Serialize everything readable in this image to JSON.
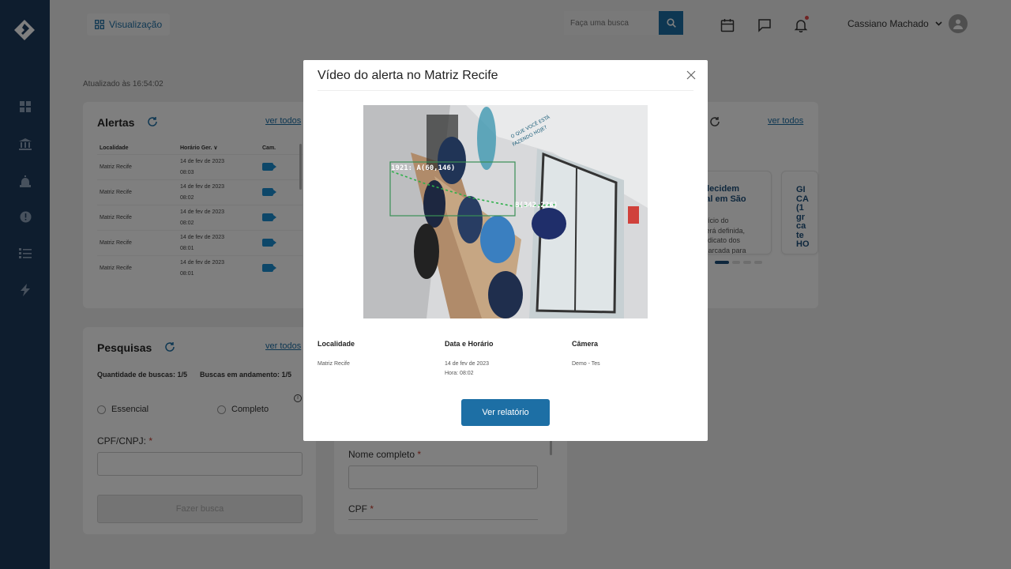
{
  "topbar": {
    "viz_label": "Visualização",
    "search_placeholder": "Faça uma busca",
    "user_name": "Cassiano Machado"
  },
  "updated_text": "Atualizado às 16:54:02",
  "alerts": {
    "title": "Alertas",
    "ver_todos": "ver todos",
    "headers": [
      "Localidade",
      "Horário Ger.",
      "Cam."
    ],
    "rows": [
      {
        "local": "Matriz Recife",
        "date": "14 de fev de 2023",
        "time": "08:03"
      },
      {
        "local": "Matriz Recife",
        "date": "14 de fev de 2023",
        "time": "08:02"
      },
      {
        "local": "Matriz Recife",
        "date": "14 de fev de 2023",
        "time": "08:02"
      },
      {
        "local": "Matriz Recife",
        "date": "14 de fev de 2023",
        "time": "08:01"
      },
      {
        "local": "Matriz Recife",
        "date": "14 de fev de 2023",
        "time": "08:01"
      }
    ]
  },
  "news": {
    "ver_todos": "ver todos",
    "card1_title_1": "elecidem",
    "card1_title_2": "ral em São",
    "card1_text_1": "início do",
    "card1_text_2": "será definida,",
    "card1_text_3": "indicato dos",
    "card1_text_4": "marcada para",
    "card2_lines": [
      "GI",
      "CA",
      "(1",
      "gr",
      "ca",
      "te",
      "HO"
    ]
  },
  "pesquisas": {
    "title": "Pesquisas",
    "ver_todos": "ver todos",
    "qtd_label": "Quantidade de buscas: 1/5",
    "andamento_label": "Buscas em andamento: 1/5",
    "radio_essencial": "Essencial",
    "radio_completo": "Completo",
    "cpf_cnpj_label": "CPF/CNPJ:",
    "fazer_busca": "Fazer busca",
    "nome_label": "Nome completo",
    "cpf_label": "CPF"
  },
  "modal": {
    "title": "Vídeo do alerta no Matriz Recife",
    "localidade_label": "Localidade",
    "localidade_value": "Matriz Recife",
    "data_label": "Data e Horário",
    "data_value": "14 de fev de 2023",
    "hora_value": "Hora: 08:02",
    "camera_label": "Câmera",
    "camera_value": "Demo - Tes",
    "report_button": "Ver relatório",
    "overlay_label_1": "1921: A(60,146)",
    "overlay_label_2": "B(342,226)",
    "wall_text_1": "O QUE VOCÊ ESTÁ",
    "wall_text_2": "FAZENDO HOJE?"
  },
  "colors": {
    "sidebar": "#1d3a5c",
    "accent": "#1d6fa5",
    "camera_icon": "#1b8fd3"
  }
}
